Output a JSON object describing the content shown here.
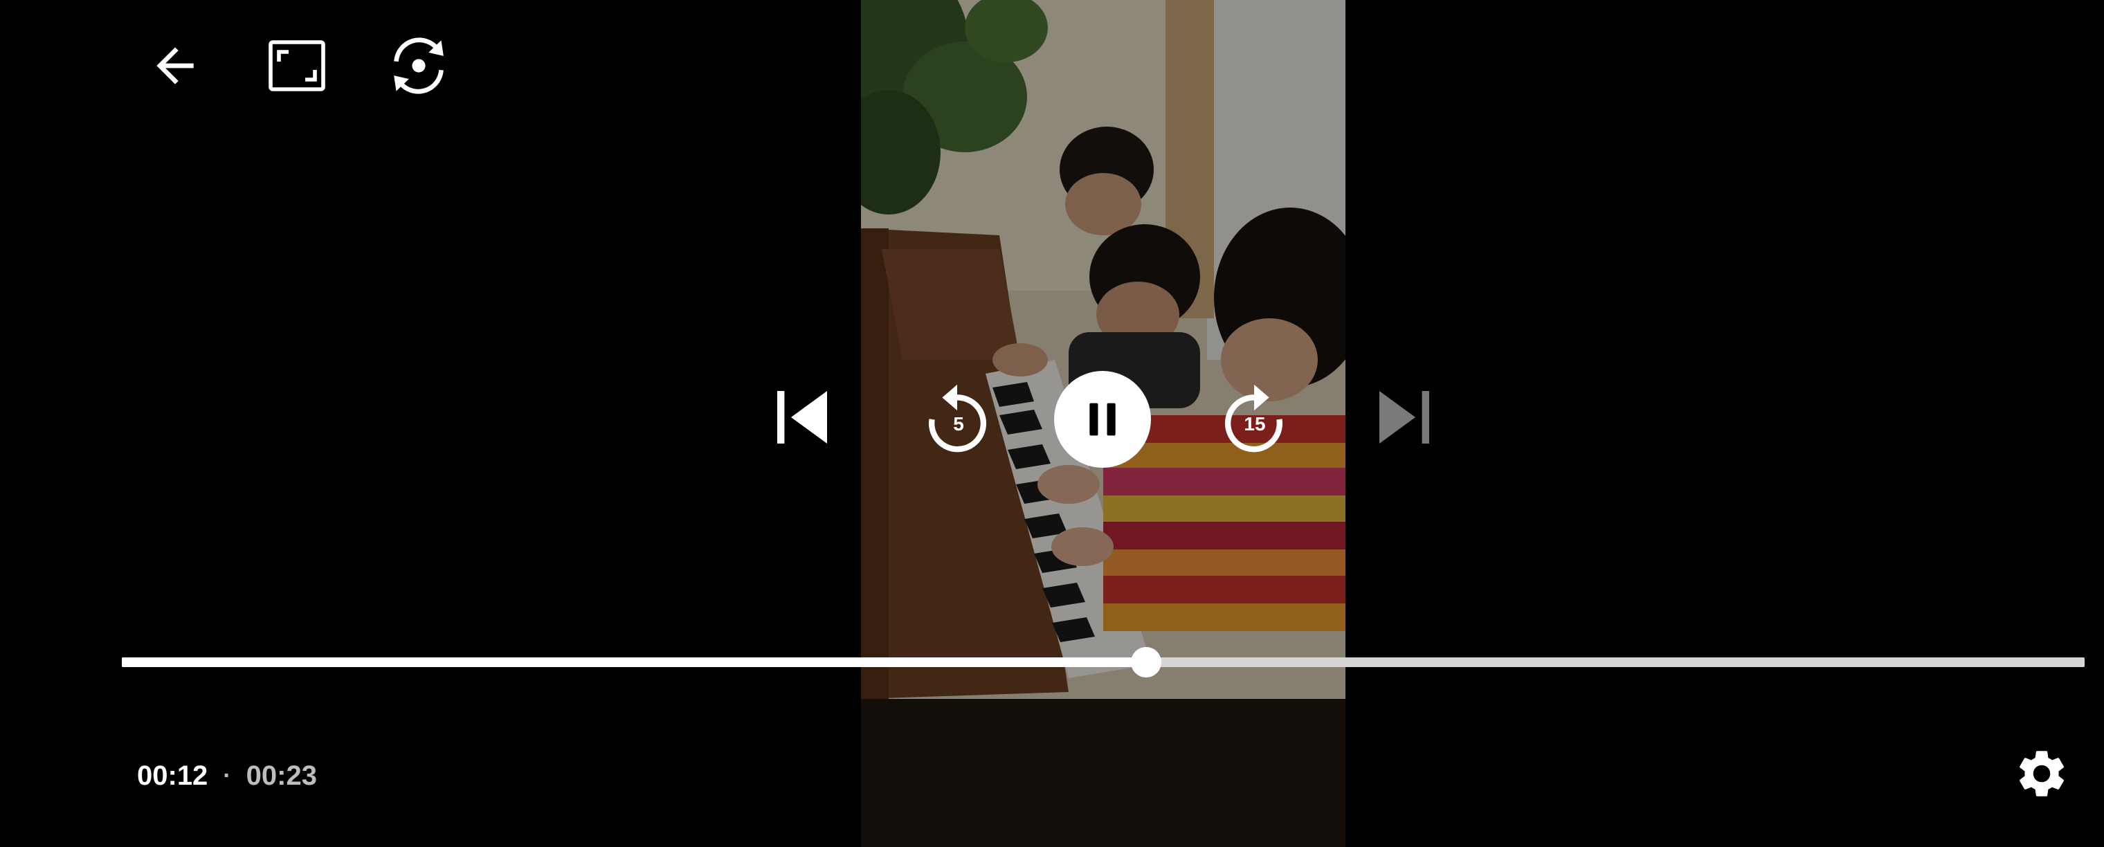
{
  "top_bar": {
    "back_icon": "arrow-left-icon",
    "fit_icon": "aspect-ratio-icon",
    "rotate_icon": "screen-rotate-icon"
  },
  "controls": {
    "prev_icon": "skip-previous-icon",
    "rewind_icon": "replay-icon",
    "rewind_seconds": "5",
    "play_pause_icon": "pause-icon",
    "forward_icon": "forward-icon",
    "forward_seconds": "15",
    "next_icon": "skip-next-icon",
    "next_enabled": false
  },
  "playback": {
    "current_time": "00:12",
    "separator": "·",
    "total_time": "00:23",
    "progress_fraction": 0.522
  },
  "settings_icon": "gear-icon",
  "colors": {
    "background": "#000000",
    "control": "#ffffff",
    "control_disabled": "#7a7a7a",
    "track_remaining": "#d6d6d6",
    "total_time_text": "#bdbdbd"
  }
}
